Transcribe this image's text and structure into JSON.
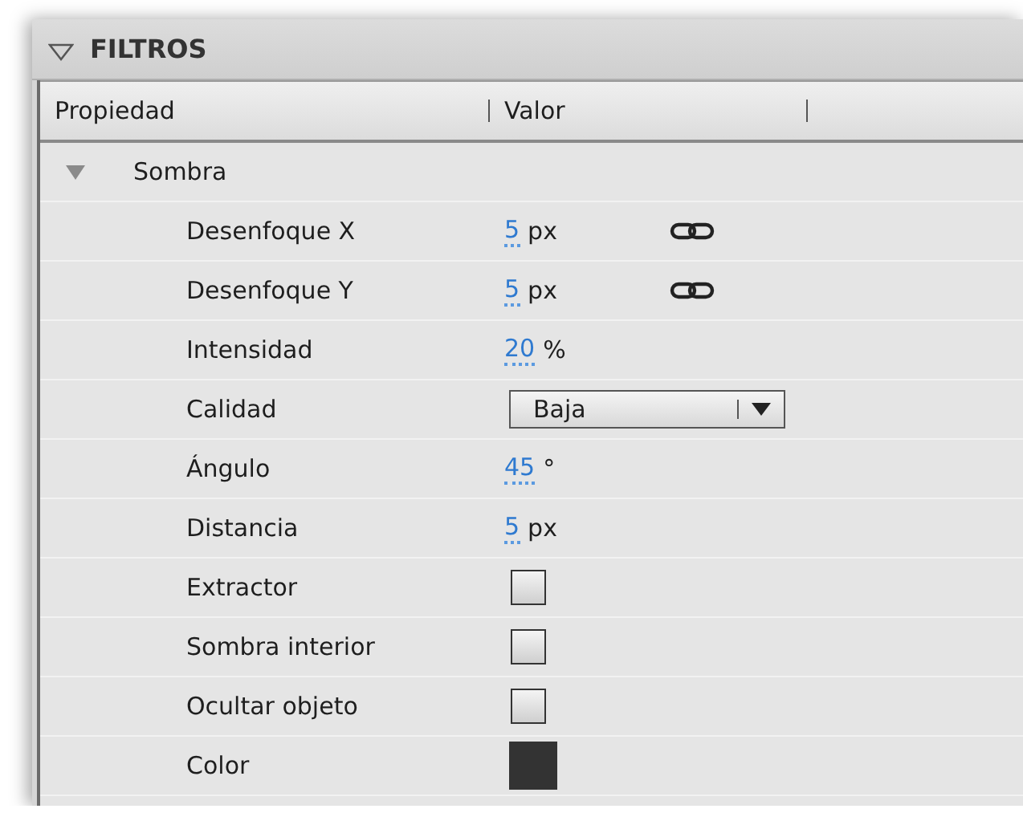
{
  "panel": {
    "title": "FILTROS",
    "expanded": true
  },
  "columns": [
    "Propiedad",
    "Valor"
  ],
  "group": {
    "label": "Sombra",
    "expanded": true,
    "rows": [
      {
        "kind": "number",
        "label": "Desenfoque X",
        "value": "5",
        "unit": "px",
        "linked": true
      },
      {
        "kind": "number",
        "label": "Desenfoque Y",
        "value": "5",
        "unit": "px",
        "linked": true
      },
      {
        "kind": "number",
        "label": "Intensidad",
        "value": "20",
        "unit": "%",
        "linked": false
      },
      {
        "kind": "select",
        "label": "Calidad",
        "value": "Baja"
      },
      {
        "kind": "number",
        "label": "Ángulo",
        "value": "45",
        "unit": "°",
        "linked": false
      },
      {
        "kind": "number",
        "label": "Distancia",
        "value": "5",
        "unit": "px",
        "linked": false
      },
      {
        "kind": "checkbox",
        "label": "Extractor",
        "checked": false
      },
      {
        "kind": "checkbox",
        "label": "Sombra interior",
        "checked": false
      },
      {
        "kind": "checkbox",
        "label": "Ocultar objeto",
        "checked": false
      },
      {
        "kind": "color",
        "label": "Color",
        "color": "#333333"
      }
    ]
  }
}
